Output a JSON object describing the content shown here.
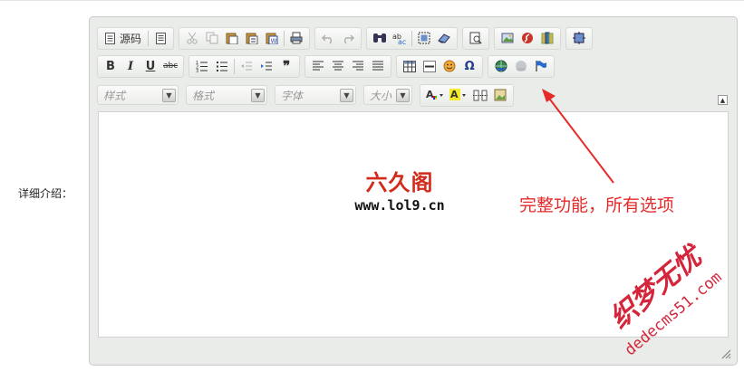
{
  "field": {
    "label": "详细介绍："
  },
  "toolbar": {
    "source_label": "源码",
    "style_combo": "样式",
    "format_combo": "格式",
    "font_combo": "字体",
    "size_combo": "大小"
  },
  "content": {
    "logo_text": "六久阁",
    "logo_url": "www.lol9.cn"
  },
  "annotation": {
    "text": "完整功能，所有选项"
  },
  "watermark": {
    "text_cn": "织梦无忧",
    "text_url": "dedecms51.com"
  },
  "colors": {
    "annotation": "#e52a2a",
    "logo": "#d22a1b",
    "watermark": "#d4253a"
  }
}
